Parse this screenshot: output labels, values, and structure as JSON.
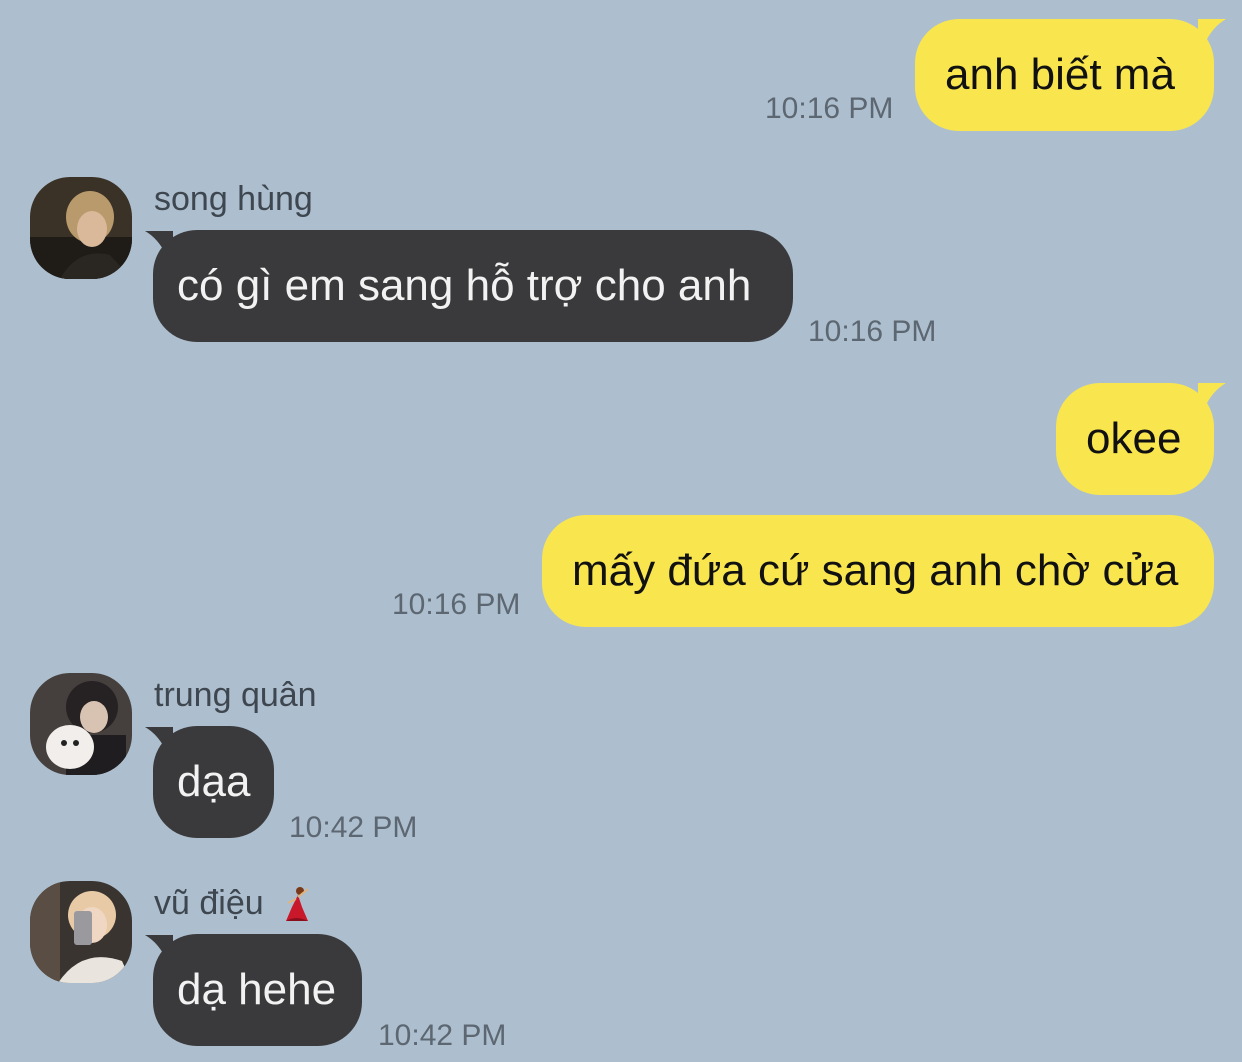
{
  "messages": [
    {
      "text": "anh biết mà",
      "time": "10:16 PM"
    },
    {
      "sender": "song hùng",
      "text": "có gì em sang hỗ trợ cho anh",
      "time": "10:16 PM"
    },
    {
      "text": "okee"
    },
    {
      "text": "mấy đứa cứ sang anh chờ cửa",
      "time": "10:16 PM"
    },
    {
      "sender": "trung quân",
      "text": "dạa",
      "time": "10:42 PM"
    },
    {
      "sender": "vũ điệu",
      "sender_emoji": "dancer-emoji-icon",
      "text": "dạ hehe",
      "time": "10:42 PM"
    }
  ],
  "colors": {
    "background": "#adbfce",
    "outgoing_bubble": "#f9e64f",
    "incoming_bubble": "#3a3a3c"
  }
}
